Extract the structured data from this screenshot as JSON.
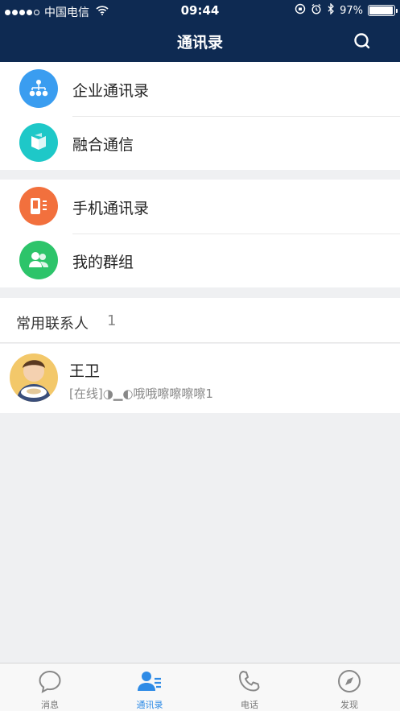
{
  "status_bar": {
    "carrier": "中国电信",
    "time": "09:44",
    "battery": "97%",
    "battery_level": 0.97
  },
  "header": {
    "title": "通讯录"
  },
  "menu_groups": [
    [
      {
        "label": "企业通讯录",
        "icon": "org-chart-icon",
        "color": "#3a9df0"
      },
      {
        "label": "融合通信",
        "icon": "fusion-box-icon",
        "color": "#1ec8c8"
      }
    ],
    [
      {
        "label": "手机通讯录",
        "icon": "phone-contacts-icon",
        "color": "#f2703d"
      },
      {
        "label": "我的群组",
        "icon": "group-icon",
        "color": "#2dc46a"
      }
    ]
  ],
  "frequent_contacts": {
    "title": "常用联系人",
    "count": "1",
    "items": [
      {
        "name": "王卫",
        "status": "[在线]◑▁◐哦哦嚓嚓嚓嚓1"
      }
    ]
  },
  "tabbar": {
    "active": 1,
    "tabs": [
      {
        "label": "消息",
        "icon": "message-bubble-icon"
      },
      {
        "label": "通讯录",
        "icon": "contacts-icon"
      },
      {
        "label": "电话",
        "icon": "phone-icon"
      },
      {
        "label": "发现",
        "icon": "compass-icon"
      }
    ]
  },
  "colors": {
    "header_bg": "#0e2a52",
    "accent": "#2e8be6"
  }
}
